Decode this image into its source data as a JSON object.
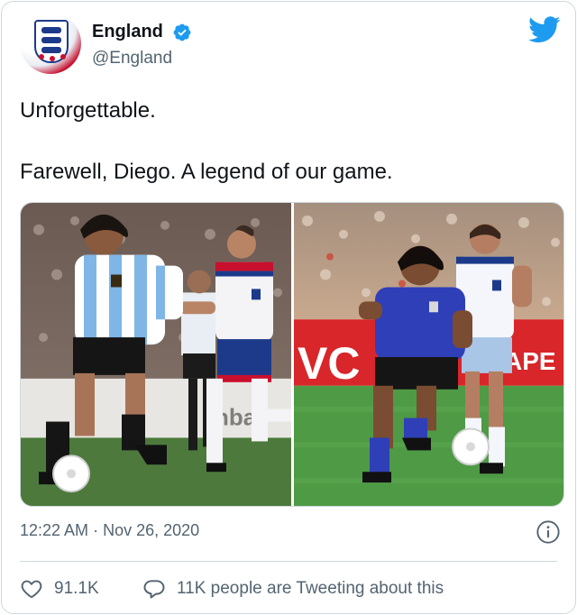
{
  "account": {
    "display_name": "England",
    "handle": "@England",
    "verified": true,
    "avatar_icon": "england-crest-icon"
  },
  "tweet": {
    "lines": [
      "Unforgettable.",
      "Farewell, Diego. A legend of our game."
    ]
  },
  "media": {
    "photo_count": 2,
    "board_text": "TAPE",
    "board_text_alt": "VC"
  },
  "meta": {
    "time": "12:22 AM",
    "separator": "·",
    "date": "Nov 26, 2020"
  },
  "actions": {
    "likes": "91.1K",
    "conversation": "11K people are Tweeting about this"
  },
  "colors": {
    "brand_blue": "#1d9bf0",
    "text_primary": "#0f1419",
    "text_secondary": "#536471",
    "border": "#cfd9de"
  },
  "icons": [
    "twitter-bird-icon",
    "verified-badge-icon",
    "info-icon",
    "heart-icon",
    "reply-bubble-icon"
  ]
}
